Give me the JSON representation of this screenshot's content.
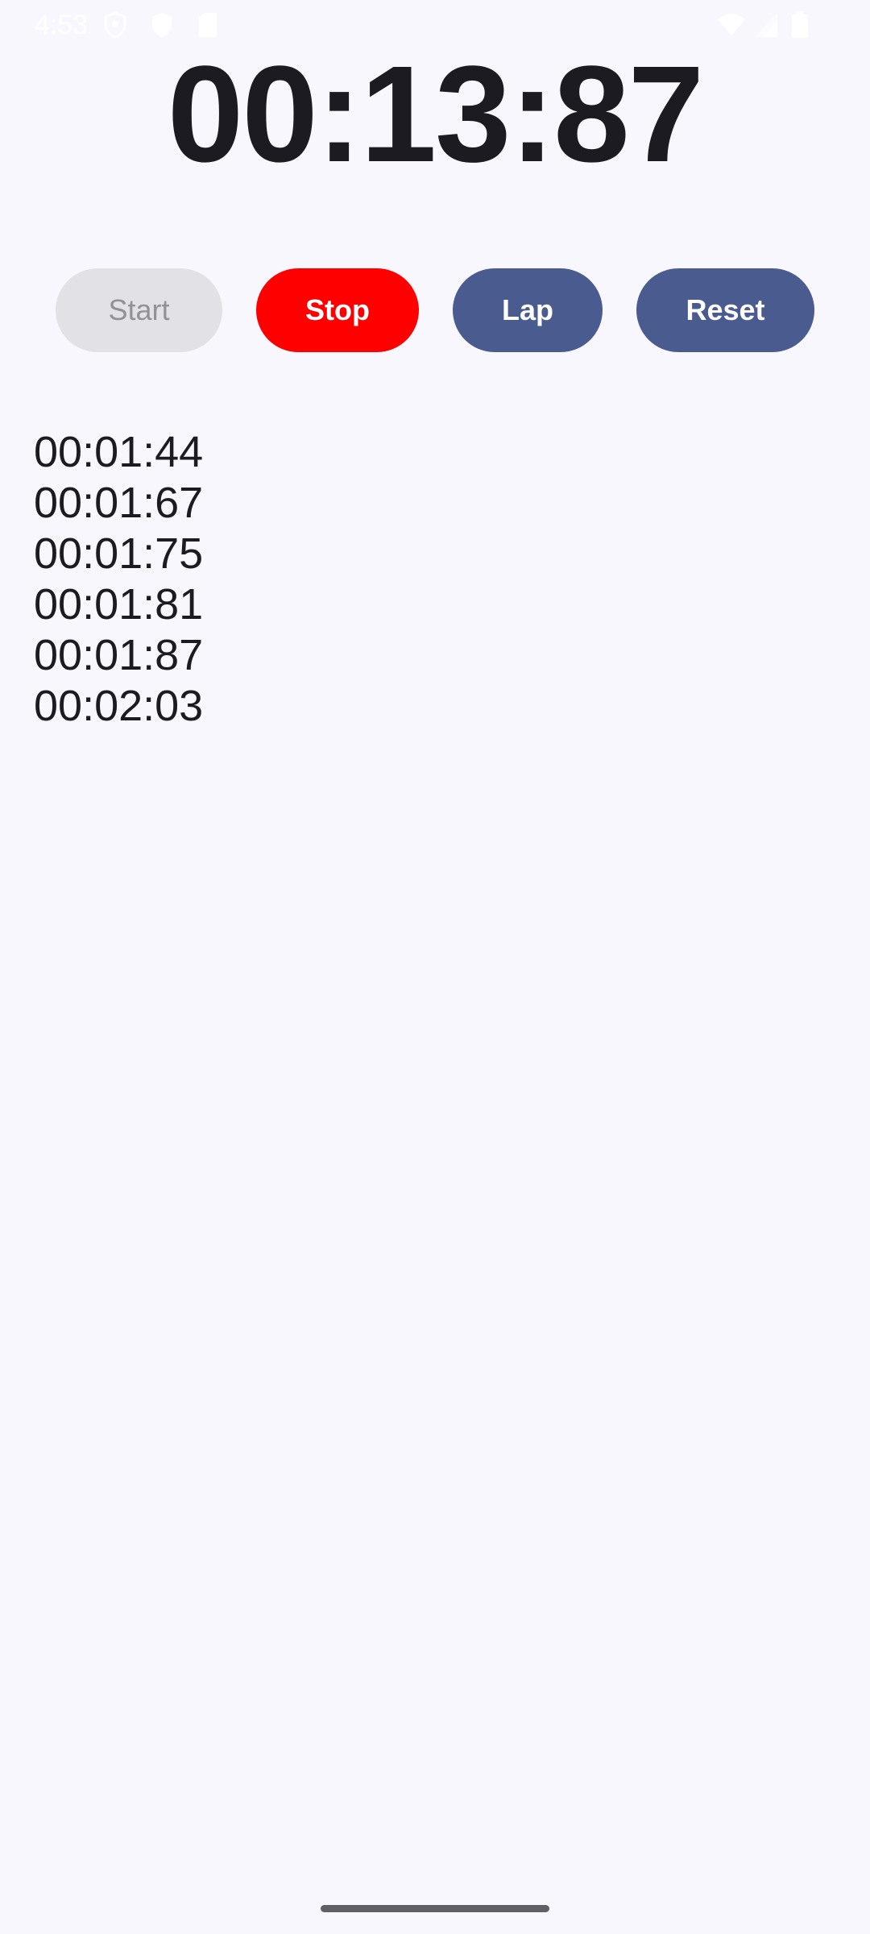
{
  "status_bar": {
    "time": "4:53",
    "icons": [
      "shield-outline-icon",
      "shield-filled-icon",
      "sd-card-icon",
      "wifi-icon",
      "cellular-signal-icon",
      "battery-icon"
    ]
  },
  "timer": {
    "display": "00:13:87"
  },
  "buttons": {
    "start": "Start",
    "stop": "Stop",
    "lap": "Lap",
    "reset": "Reset"
  },
  "laps": [
    "00:01:44",
    "00:01:67",
    "00:01:75",
    "00:01:81",
    "00:01:87",
    "00:02:03"
  ],
  "colors": {
    "background": "#f8f7fd",
    "stop_button": "#ff0000",
    "primary_button": "#4a5b8f",
    "disabled_button": "#e1e1e6",
    "disabled_text": "#919197"
  }
}
